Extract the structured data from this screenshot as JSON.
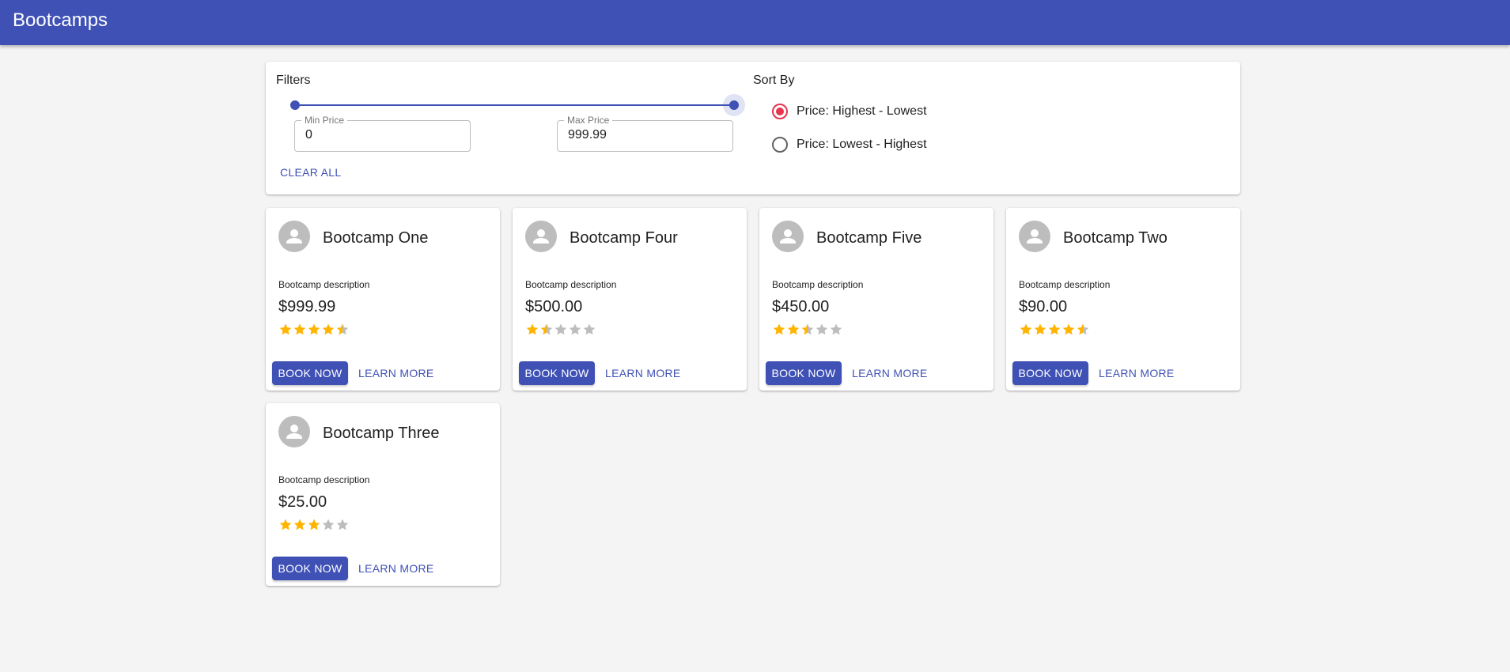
{
  "appbar": {
    "title": "Bootcamps",
    "color": "#3f51b5"
  },
  "filters": {
    "title": "Filters",
    "price_range": {
      "min": 0,
      "max": 999.99
    },
    "min_price": {
      "label": "Min Price",
      "value": "0"
    },
    "max_price": {
      "label": "Max Price",
      "value": "999.99"
    },
    "clear_all": "CLEAR ALL"
  },
  "sort": {
    "title": "Sort By",
    "options": [
      {
        "label": "Price: Highest - Lowest",
        "checked": true
      },
      {
        "label": "Price: Lowest - Highest",
        "checked": false
      }
    ],
    "accent": "#e8344e"
  },
  "cards": [
    {
      "title": "Bootcamp One",
      "description": "Bootcamp description",
      "price": "$999.99",
      "rating": 4.5,
      "book": "BOOK NOW",
      "learn": "LEARN MORE"
    },
    {
      "title": "Bootcamp Four",
      "description": "Bootcamp description",
      "price": "$500.00",
      "rating": 1.5,
      "book": "BOOK NOW",
      "learn": "LEARN MORE"
    },
    {
      "title": "Bootcamp Five",
      "description": "Bootcamp description",
      "price": "$450.00",
      "rating": 2.5,
      "book": "BOOK NOW",
      "learn": "LEARN MORE"
    },
    {
      "title": "Bootcamp Two",
      "description": "Bootcamp description",
      "price": "$90.00",
      "rating": 4.5,
      "book": "BOOK NOW",
      "learn": "LEARN MORE"
    },
    {
      "title": "Bootcamp Three",
      "description": "Bootcamp description",
      "price": "$25.00",
      "rating": 3,
      "book": "BOOK NOW",
      "learn": "LEARN MORE"
    }
  ],
  "icons": {
    "avatar": "person-icon",
    "star": "star-icon"
  },
  "colors": {
    "star_filled": "#ffb400",
    "star_empty": "#bdbdbd"
  }
}
